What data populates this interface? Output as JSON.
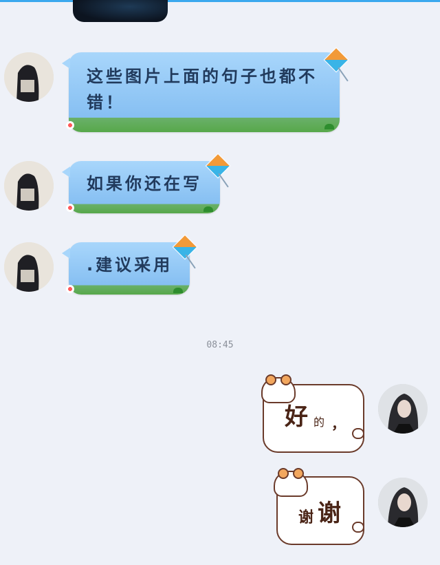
{
  "messages": {
    "incoming": [
      {
        "text": "这些图片上面的句子也都不错！"
      },
      {
        "text": "如果你还在写"
      },
      {
        "text": ".建议采用"
      }
    ],
    "timestamp": "08:45",
    "outgoing": [
      {
        "main": "好",
        "rest": "的",
        "punct": "，"
      },
      {
        "main": "谢",
        "second": "谢"
      }
    ]
  },
  "colors": {
    "background": "#eef1f8",
    "incoming_bubble": "#9fd0f8",
    "outgoing_border": "#6a3a2a",
    "top_accent": "#3aa8ee"
  },
  "icons": [
    "kite-icon",
    "hamster-sticker-icon",
    "grass-decoration",
    "flower-decoration",
    "avatar"
  ]
}
